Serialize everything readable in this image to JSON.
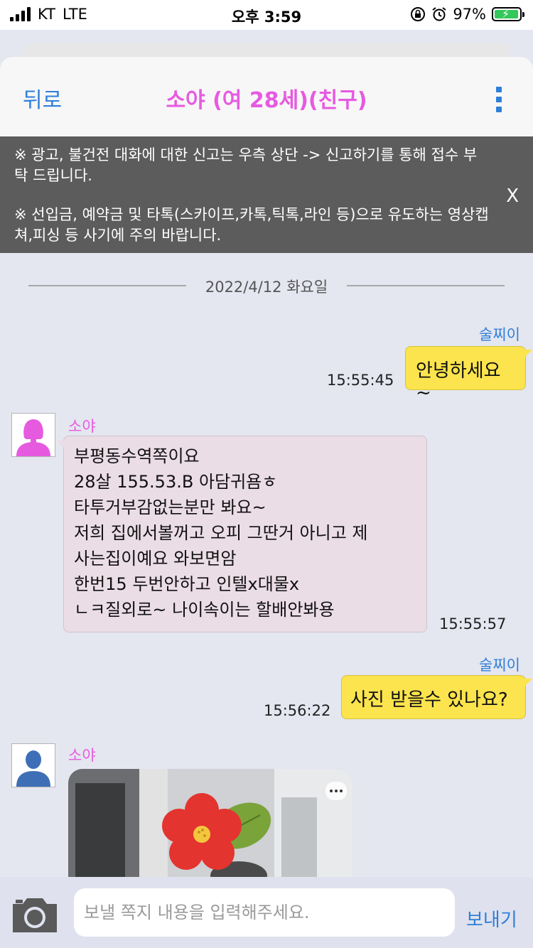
{
  "status_bar": {
    "carrier": "KT",
    "network": "LTE",
    "time": "오후 3:59",
    "battery_percent": "97%",
    "battery_level": 0.97
  },
  "header": {
    "back_label": "뒤로",
    "title": "소야 (여 28세)(친구)"
  },
  "notice": {
    "line1": "※ 광고, 불건전 대화에 대한 신고는 우측 상단 -> 신고하기를 통해 접수 부탁 드립니다.",
    "line2": "※ 선입금, 예약금 및 타톡(스카이프,카톡,틱톡,라인 등)으로 유도하는 영상캡쳐,피싱 등 사기에 주의 바랍니다.",
    "close_label": "X"
  },
  "date_separator": "2022/4/12 화요일",
  "messages": [
    {
      "from": "me",
      "sender": "술찌이",
      "text": "안녕하세요~",
      "time": "15:55:45"
    },
    {
      "from": "other",
      "sender": "소야",
      "lines": [
        "부평동수역쪽이요",
        "28살 155.53.B 아담귀욤ㅎ",
        "타투거부감없는분만 봐요~",
        "저희 집에서볼꺼고 오피 그딴거 아니고 제",
        "사는집이예요 와보면암",
        "한번15 두번안하고 인텔x대물x",
        "ㄴㅋ질외로~ 나이속이는 할배안봐용"
      ],
      "time": "15:55:57"
    },
    {
      "from": "me",
      "sender": "술찌이",
      "text": "사진 받을수 있나요?",
      "time": "15:56:22"
    },
    {
      "from": "other",
      "sender": "소야",
      "type": "image"
    }
  ],
  "composer": {
    "placeholder": "보낼 쪽지 내용을 입력해주세요.",
    "send_label": "보내기"
  },
  "colors": {
    "accent_blue": "#2f7fd9",
    "name_pink": "#e65ae0",
    "my_bubble": "#fbe44d",
    "other_bubble": "#ebdde6",
    "notice_bg": "#5c5c5c"
  }
}
